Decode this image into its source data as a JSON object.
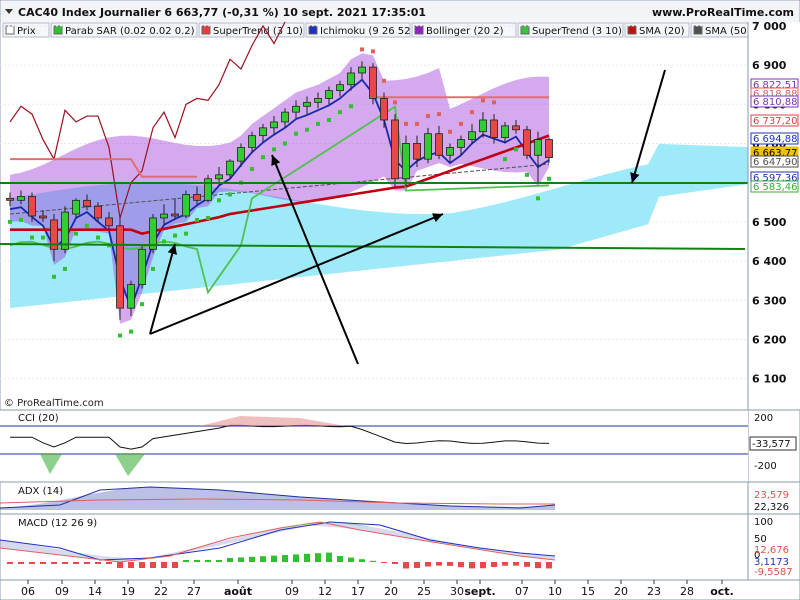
{
  "header": {
    "title": "CAC40 Index Journalier 6 663,77 (-0,31 %) 10 sept. 2021 17:35:01",
    "site": "www.ProRealTime.com",
    "copyright": "© ProRealTime.com"
  },
  "legend": [
    {
      "label": "Prix",
      "color": "#ffffff"
    },
    {
      "label": "Parab SAR (0.02 0.02 0.2)",
      "color": "#30c030"
    },
    {
      "label": "SuperTrend (3 10)",
      "color": "#e04040"
    },
    {
      "label": "Ichimoku (9 26 52)",
      "color": "#2030c0"
    },
    {
      "label": "Bollinger (20 2)",
      "color": "#9020c0"
    },
    {
      "label": "SuperTrend (3 10)",
      "color": "#40c040"
    },
    {
      "label": "SMA (20)",
      "color": "#c01010"
    },
    {
      "label": "SMA (50)",
      "color": "#505050"
    }
  ],
  "price_labels": [
    {
      "text": "6 822,51",
      "color": "#8030c0"
    },
    {
      "text": "6 818,88",
      "color": "#e06060"
    },
    {
      "text": "6 810,88",
      "color": "#8030c0"
    },
    {
      "text": "6 737,20",
      "color": "#e04040"
    },
    {
      "text": "6 694,88",
      "color": "#2030c0"
    },
    {
      "text": "6 663,77",
      "color": "#e8c000"
    },
    {
      "text": "6 647,90",
      "color": "#505050"
    },
    {
      "text": "6 597,36",
      "color": "#2030c0"
    },
    {
      "text": "6 583,46",
      "color": "#30b030"
    }
  ],
  "indicators": {
    "cci": {
      "label": "CCI (20)",
      "ticks": [
        "200",
        "-200"
      ],
      "value": "-33,577"
    },
    "adx": {
      "label": "ADX (14)",
      "values": [
        "23,579",
        "22,326"
      ]
    },
    "macd": {
      "label": "MACD (12 26 9)",
      "ticks": [
        "100",
        "50",
        "0"
      ],
      "values": [
        "12,676",
        "3,1173",
        "-9,5587"
      ]
    }
  },
  "chart_data": {
    "type": "candlestick",
    "title": "CAC40 Index Journalier 6 663,77 (-0,31 %) 10 sept. 2021 17:35:01",
    "y_ticks": [
      7000,
      6900,
      6800,
      6700,
      6600,
      6500,
      6400,
      6300,
      6200,
      6100
    ],
    "y_tick_labels": [
      "7 000",
      "6 900",
      "6 800",
      "6 700",
      "6 600",
      "6 500",
      "6 400",
      "6 300",
      "6 200",
      "6 100"
    ],
    "ylim": [
      6020,
      7010
    ],
    "x_labels": [
      "06",
      "09",
      "14",
      "19",
      "22",
      "27",
      "août",
      "09",
      "12",
      "17",
      "20",
      "25",
      "30",
      "sept.",
      "07",
      "10",
      "15",
      "20",
      "23",
      "28",
      "oct."
    ],
    "candles": [
      {
        "o": 6560,
        "h": 6575,
        "l": 6540,
        "c": 6555
      },
      {
        "o": 6555,
        "h": 6580,
        "l": 6545,
        "c": 6565
      },
      {
        "o": 6565,
        "h": 6575,
        "l": 6500,
        "c": 6515
      },
      {
        "o": 6515,
        "h": 6530,
        "l": 6500,
        "c": 6510
      },
      {
        "o": 6505,
        "h": 6520,
        "l": 6400,
        "c": 6430
      },
      {
        "o": 6430,
        "h": 6540,
        "l": 6420,
        "c": 6525
      },
      {
        "o": 6520,
        "h": 6560,
        "l": 6510,
        "c": 6555
      },
      {
        "o": 6555,
        "h": 6570,
        "l": 6530,
        "c": 6540
      },
      {
        "o": 6540,
        "h": 6550,
        "l": 6500,
        "c": 6510
      },
      {
        "o": 6510,
        "h": 6525,
        "l": 6480,
        "c": 6490
      },
      {
        "o": 6490,
        "h": 6510,
        "l": 6250,
        "c": 6280
      },
      {
        "o": 6280,
        "h": 6350,
        "l": 6260,
        "c": 6340
      },
      {
        "o": 6340,
        "h": 6440,
        "l": 6330,
        "c": 6430
      },
      {
        "o": 6430,
        "h": 6520,
        "l": 6420,
        "c": 6510
      },
      {
        "o": 6510,
        "h": 6545,
        "l": 6490,
        "c": 6520
      },
      {
        "o": 6520,
        "h": 6560,
        "l": 6505,
        "c": 6515
      },
      {
        "o": 6515,
        "h": 6580,
        "l": 6510,
        "c": 6570
      },
      {
        "o": 6570,
        "h": 6590,
        "l": 6545,
        "c": 6555
      },
      {
        "o": 6555,
        "h": 6620,
        "l": 6550,
        "c": 6610
      },
      {
        "o": 6610,
        "h": 6640,
        "l": 6595,
        "c": 6620
      },
      {
        "o": 6620,
        "h": 6660,
        "l": 6610,
        "c": 6655
      },
      {
        "o": 6655,
        "h": 6700,
        "l": 6640,
        "c": 6690
      },
      {
        "o": 6690,
        "h": 6730,
        "l": 6675,
        "c": 6720
      },
      {
        "o": 6720,
        "h": 6750,
        "l": 6705,
        "c": 6740
      },
      {
        "o": 6740,
        "h": 6770,
        "l": 6725,
        "c": 6755
      },
      {
        "o": 6755,
        "h": 6790,
        "l": 6740,
        "c": 6780
      },
      {
        "o": 6780,
        "h": 6810,
        "l": 6765,
        "c": 6795
      },
      {
        "o": 6795,
        "h": 6820,
        "l": 6775,
        "c": 6805
      },
      {
        "o": 6805,
        "h": 6830,
        "l": 6790,
        "c": 6815
      },
      {
        "o": 6815,
        "h": 6845,
        "l": 6800,
        "c": 6835
      },
      {
        "o": 6835,
        "h": 6860,
        "l": 6820,
        "c": 6850
      },
      {
        "o": 6850,
        "h": 6895,
        "l": 6835,
        "c": 6880
      },
      {
        "o": 6880,
        "h": 6910,
        "l": 6865,
        "c": 6895
      },
      {
        "o": 6895,
        "h": 6905,
        "l": 6800,
        "c": 6815
      },
      {
        "o": 6815,
        "h": 6830,
        "l": 6740,
        "c": 6760
      },
      {
        "o": 6760,
        "h": 6775,
        "l": 6590,
        "c": 6610
      },
      {
        "o": 6610,
        "h": 6720,
        "l": 6590,
        "c": 6700
      },
      {
        "o": 6700,
        "h": 6720,
        "l": 6640,
        "c": 6660
      },
      {
        "o": 6660,
        "h": 6740,
        "l": 6650,
        "c": 6725
      },
      {
        "o": 6725,
        "h": 6745,
        "l": 6660,
        "c": 6670
      },
      {
        "o": 6670,
        "h": 6700,
        "l": 6650,
        "c": 6690
      },
      {
        "o": 6690,
        "h": 6720,
        "l": 6670,
        "c": 6710
      },
      {
        "o": 6710,
        "h": 6750,
        "l": 6700,
        "c": 6730
      },
      {
        "o": 6730,
        "h": 6780,
        "l": 6715,
        "c": 6760
      },
      {
        "o": 6760,
        "h": 6775,
        "l": 6700,
        "c": 6715
      },
      {
        "o": 6715,
        "h": 6755,
        "l": 6700,
        "c": 6745
      },
      {
        "o": 6745,
        "h": 6760,
        "l": 6725,
        "c": 6735
      },
      {
        "o": 6735,
        "h": 6745,
        "l": 6660,
        "c": 6670
      },
      {
        "o": 6670,
        "h": 6730,
        "l": 6600,
        "c": 6710
      },
      {
        "o": 6710,
        "h": 6715,
        "l": 6650,
        "c": 6664
      }
    ]
  }
}
